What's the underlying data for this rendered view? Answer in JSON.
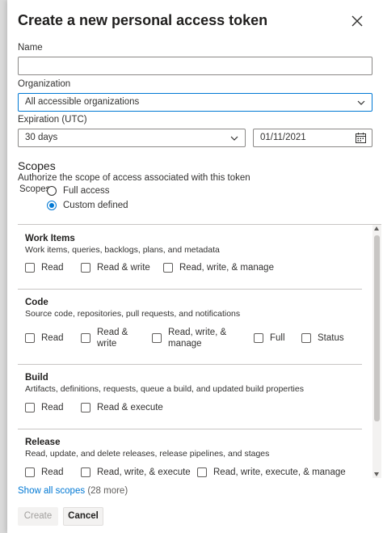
{
  "dialog": {
    "title": "Create a new personal access token",
    "close_icon": "close-icon"
  },
  "form": {
    "name_label": "Name",
    "name_value": "",
    "organization_label": "Organization",
    "organization_value": "All accessible organizations",
    "expiration_label": "Expiration (UTC)",
    "expiration_value": "30 days",
    "expiration_date": "01/11/2021",
    "scopes_heading": "Scopes",
    "scopes_description": "Authorize the scope of access associated with this token",
    "scopes_label": "Scopes",
    "radio_full_access": "Full access",
    "radio_custom_defined": "Custom defined",
    "selected_scope_mode": "Custom defined"
  },
  "sections": [
    {
      "title": "Work Items",
      "description": "Work items, queries, backlogs, plans, and metadata",
      "options": [
        "Read",
        "Read & write",
        "Read, write, & manage"
      ]
    },
    {
      "title": "Code",
      "description": "Source code, repositories, pull requests, and notifications",
      "options": [
        "Read",
        "Read & write",
        "Read, write, & manage",
        "Full",
        "Status"
      ]
    },
    {
      "title": "Build",
      "description": "Artifacts, definitions, requests, queue a build, and updated build properties",
      "options": [
        "Read",
        "Read & execute"
      ]
    },
    {
      "title": "Release",
      "description": "Read, update, and delete releases, release pipelines, and stages",
      "options": [
        "Read",
        "Read, write, & execute",
        "Read, write, execute, & manage"
      ]
    }
  ],
  "footer": {
    "show_all_label": "Show all scopes",
    "show_all_count": "(28 more)",
    "create_label": "Create",
    "cancel_label": "Cancel"
  },
  "colors": {
    "accent": "#0078d4",
    "border": "#8a8886",
    "disabled_text": "#a19f9d"
  }
}
